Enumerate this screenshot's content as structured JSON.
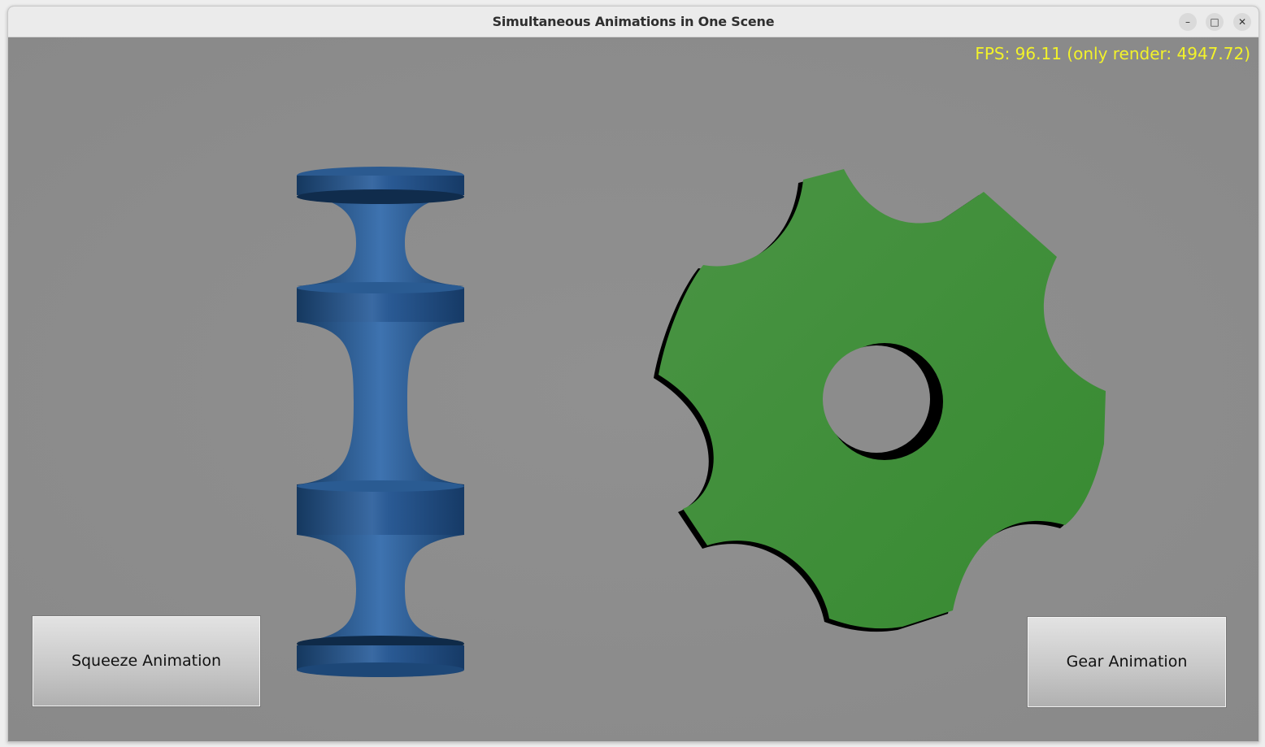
{
  "window": {
    "title": "Simultaneous Animations in One Scene",
    "controls": {
      "minimize_glyph": "–",
      "maximize_glyph": "□",
      "close_glyph": "✕"
    }
  },
  "overlay": {
    "fps_text": "FPS: 96.11 (only render: 4947.72)",
    "fps_color": "#f2f22a"
  },
  "scene": {
    "background_color": "#8c8c8c",
    "squeeze_object_color": "#1f4f86",
    "gear_object_color": "#3f8f3c"
  },
  "buttons": {
    "squeeze_label": "Squeeze Animation",
    "gear_label": "Gear Animation"
  }
}
